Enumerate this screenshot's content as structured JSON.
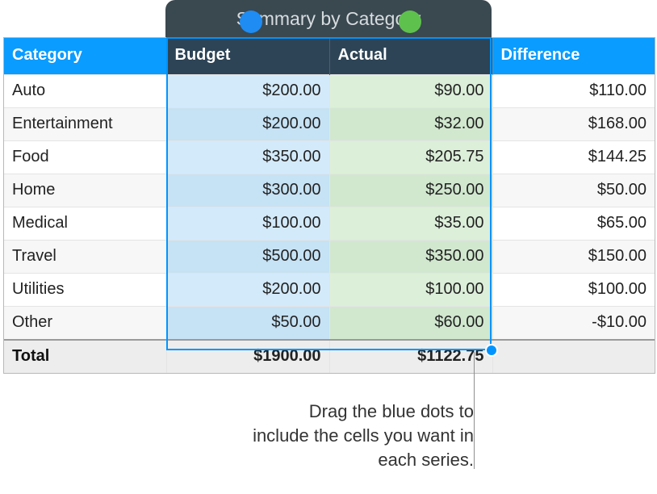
{
  "title": "Summary by Category",
  "columns": {
    "category": "Category",
    "budget": "Budget",
    "actual": "Actual",
    "difference": "Difference"
  },
  "rows": [
    {
      "category": "Auto",
      "budget": "$200.00",
      "actual": "$90.00",
      "difference": "$110.00"
    },
    {
      "category": "Entertainment",
      "budget": "$200.00",
      "actual": "$32.00",
      "difference": "$168.00"
    },
    {
      "category": "Food",
      "budget": "$350.00",
      "actual": "$205.75",
      "difference": "$144.25"
    },
    {
      "category": "Home",
      "budget": "$300.00",
      "actual": "$250.00",
      "difference": "$50.00"
    },
    {
      "category": "Medical",
      "budget": "$100.00",
      "actual": "$35.00",
      "difference": "$65.00"
    },
    {
      "category": "Travel",
      "budget": "$500.00",
      "actual": "$350.00",
      "difference": "$150.00"
    },
    {
      "category": "Utilities",
      "budget": "$200.00",
      "actual": "$100.00",
      "difference": "$100.00"
    },
    {
      "category": "Other",
      "budget": "$50.00",
      "actual": "$60.00",
      "difference": "-$10.00"
    }
  ],
  "total": {
    "label": "Total",
    "budget": "$1900.00",
    "actual": "$1122.75",
    "difference": ""
  },
  "callout": "Drag the blue dots to include the cells you want in each series.",
  "series_legend": {
    "budget_color": "#1e8cf3",
    "actual_color": "#5fc14d"
  },
  "chart_data": {
    "type": "table",
    "title": "Summary by Category",
    "columns": [
      "Category",
      "Budget",
      "Actual",
      "Difference"
    ],
    "series": [
      {
        "name": "Budget",
        "values": [
          200.0,
          200.0,
          350.0,
          300.0,
          100.0,
          500.0,
          200.0,
          50.0
        ]
      },
      {
        "name": "Actual",
        "values": [
          90.0,
          32.0,
          205.75,
          250.0,
          35.0,
          350.0,
          100.0,
          60.0
        ]
      },
      {
        "name": "Difference",
        "values": [
          110.0,
          168.0,
          144.25,
          50.0,
          65.0,
          150.0,
          100.0,
          -10.0
        ]
      }
    ],
    "categories": [
      "Auto",
      "Entertainment",
      "Food",
      "Home",
      "Medical",
      "Travel",
      "Utilities",
      "Other"
    ],
    "totals": {
      "Budget": 1900.0,
      "Actual": 1122.75
    }
  }
}
